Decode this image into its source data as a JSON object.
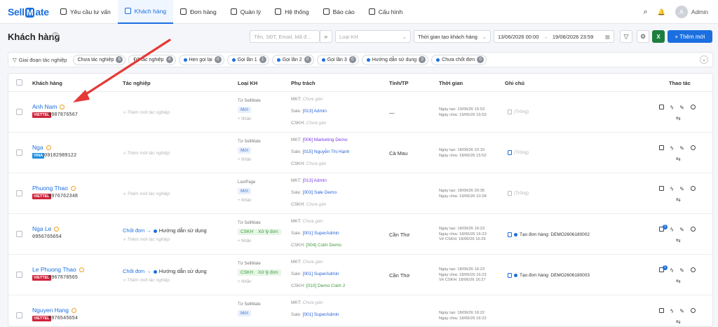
{
  "app": {
    "logo_a": "Sell",
    "logo_b": "M",
    "logo_c": "ate"
  },
  "nav": [
    {
      "label": "Yêu cầu tư vấn",
      "icon": "chat-icon",
      "active": false
    },
    {
      "label": "Khách hàng",
      "icon": "customers-icon",
      "active": true
    },
    {
      "label": "Đơn hàng",
      "icon": "cart-icon",
      "active": false
    },
    {
      "label": "Quản lý",
      "icon": "grid-icon",
      "active": false
    },
    {
      "label": "Hệ thống",
      "icon": "gear-icon",
      "active": false
    },
    {
      "label": "Báo cáo",
      "icon": "chart-icon",
      "active": false
    },
    {
      "label": "Cấu hình",
      "icon": "wrench-icon",
      "active": false
    }
  ],
  "user": {
    "name": "Admin",
    "initial": "A"
  },
  "page": {
    "title": "Khách hàng",
    "search_placeholder": "Tên, SĐT, Email, Mã đ...",
    "type_placeholder": "Loại KH",
    "time_select": "Thời gian tạo khách hàng",
    "date_from": "13/06/2026 00:00",
    "date_sep": "→",
    "date_to": "19/06/2026 23:59",
    "add_button": "+ Thêm mới"
  },
  "stages": {
    "label": "Giai đoạn tác nghiệp",
    "chips": [
      {
        "label": "Chưa tác nghiệp",
        "count": "6",
        "dot": false
      },
      {
        "label": "Đã tác nghiệp",
        "count": "4",
        "dot": false
      },
      {
        "label": "Hẹn gọi lại",
        "count": "0",
        "dot": true
      },
      {
        "label": "Gọi lần 1",
        "count": "1",
        "dot": true
      },
      {
        "label": "Gọi lần 2",
        "count": "0",
        "dot": true
      },
      {
        "label": "Gọi lần 3",
        "count": "0",
        "dot": true
      },
      {
        "label": "Hướng dẫn sử dụng",
        "count": "3",
        "dot": true
      },
      {
        "label": "Chưa chốt đơn",
        "count": "0",
        "dot": true
      }
    ]
  },
  "columns": {
    "customer": "Khách hàng",
    "work": "Tác nghiệp",
    "type": "Loại KH",
    "owner": "Phụ trách",
    "city": "Tỉnh/TP",
    "time": "Thời gian",
    "note": "Ghi chú",
    "actions": "Thao tác"
  },
  "rows": [
    {
      "name": "Anh Nam",
      "carrier": "VIETTEL",
      "carrier_color": "#d0233b",
      "phone": "0987876567",
      "work": "Thêm mới tác nghiệp",
      "work_link": "",
      "work_stage": "",
      "source": "Từ SellMate",
      "badge": "Mới",
      "badge2": "",
      "tag": "+ Nhãn",
      "mkt_label": "MKT:",
      "mkt": "Chưa gán",
      "sale_label": "Sale:",
      "sale": "[013] Admin",
      "cskh_label": "CSKH:",
      "cskh": "Chưa gán",
      "city": "—",
      "t1": "Ngày tạo: 19/06/26 15:53",
      "t2": "Ngày chia: 19/06/26 15:53",
      "t3": "",
      "note": "(Trống)",
      "note_active": false,
      "order_badge": ""
    },
    {
      "name": "Nga",
      "carrier": "VINA",
      "carrier_color": "#1d8fe0",
      "phone": "09182989122",
      "work": "Thêm mới tác nghiệp",
      "work_link": "",
      "work_stage": "",
      "source": "Từ SellMate",
      "badge": "Mới",
      "badge2": "",
      "tag": "+ Nhãn",
      "mkt_label": "MKT:",
      "mkt": "[006] Marketing Demo",
      "sale_label": "Sale:",
      "sale": "[015] Nguyễn Thị Hạnh",
      "cskh_label": "CSKH:",
      "cskh": "Chưa gán",
      "city": "Cà Mau",
      "t1": "Ngày tạo: 18/06/26 22:10",
      "t2": "Ngày chia: 18/06/26 15:52",
      "t3": "",
      "note": "(Trống)",
      "note_active": false,
      "order_badge": ""
    },
    {
      "name": "Phuong Thao",
      "carrier": "VIETTEL",
      "carrier_color": "#d0233b",
      "phone": "0976762348",
      "work": "Thêm mới tác nghiệp",
      "work_link": "",
      "work_stage": "",
      "source": "LastPage",
      "badge": "Mới",
      "badge2": "",
      "tag": "+ Nhãn",
      "mkt_label": "MKT:",
      "mkt": "[013] Admin",
      "sale_label": "Sale:",
      "sale": "[003] Sale Demo",
      "cskh_label": "CSKH:",
      "cskh": "Chưa gán",
      "city": "",
      "t1": "Ngày tạo: 18/06/26 20:35",
      "t2": "Ngày chia: 19/06/26 10:28",
      "t3": "",
      "note": "(Trống)",
      "note_active": false,
      "order_badge": ""
    },
    {
      "name": "Nga Le",
      "carrier": "",
      "carrier_color": "",
      "phone": "0956765654",
      "work": "Thêm mới tác nghiệp",
      "work_link": "Chốt đơn →",
      "work_stage": "Hướng dẫn sử dụng",
      "source": "Từ SellMate",
      "badge": "CSKH",
      "badge2": "Xử lý đơn",
      "tag": "+ Nhãn",
      "mkt_label": "MKT:",
      "mkt": "Chưa gán",
      "sale_label": "Sale:",
      "sale": "[001] SuperAdmin",
      "cskh_label": "CSKH:",
      "cskh": "[004] Cskh Demo",
      "city": "Cần Thơ",
      "t1": "Ngày tạo: 18/06/26 16:23",
      "t2": "Ngày chia: 18/06/26 16:23",
      "t3": "Về CSKH: 18/06/26 16:26",
      "note": "Tạo đơn hàng: DEMO2606180002",
      "note_active": true,
      "order_badge": "1"
    },
    {
      "name": "Le Phuong Thao",
      "carrier": "VIETTEL",
      "carrier_color": "#d0233b",
      "phone": "0967878565",
      "work": "Thêm mới tác nghiệp",
      "work_link": "Chốt đơn →",
      "work_stage": "Hướng dẫn sử dụng",
      "source": "Từ SellMate",
      "badge": "CSKH",
      "badge2": "Xử lý đơn",
      "tag": "+ Nhãn",
      "mkt_label": "MKT:",
      "mkt": "Chưa gán",
      "sale_label": "Sale:",
      "sale": "[001] SuperAdmin",
      "cskh_label": "CSKH:",
      "cskh": "[010] Demo Cskh 2",
      "city": "Cần Thơ",
      "t1": "Ngày tạo: 18/06/26 16:23",
      "t2": "Ngày chia: 18/06/26 16:23",
      "t3": "Về CSKH: 18/06/26 16:27",
      "note": "Tạo đơn hàng: DEMO2606180003",
      "note_active": true,
      "order_badge": "1"
    },
    {
      "name": "Nguyen Hang",
      "carrier": "VIETTEL",
      "carrier_color": "#d0233b",
      "phone": "0976545654",
      "work": "",
      "work_link": "",
      "work_stage": "",
      "source": "Từ SellMate",
      "badge": "Mới",
      "badge2": "",
      "tag": "",
      "mkt_label": "MKT:",
      "mkt": "Chưa gán",
      "sale_label": "Sale:",
      "sale": "[001] SuperAdmin",
      "cskh_label": "",
      "cskh": "",
      "city": "",
      "t1": "Ngày tạo: 18/06/26 16:22",
      "t2": "Ngày chia: 18/06/26 16:22",
      "t3": "",
      "note": "",
      "note_active": false,
      "order_badge": ""
    }
  ],
  "colors": {
    "accent": "#1b6fe0",
    "annotation_arrow": "#e53935"
  }
}
